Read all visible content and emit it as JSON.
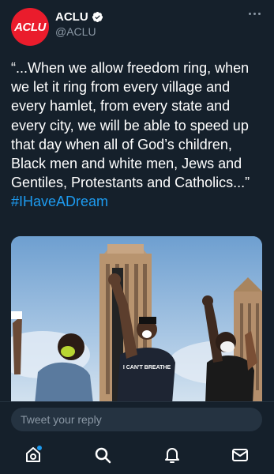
{
  "tweet": {
    "avatar_text": "ACLU",
    "display_name": "ACLU",
    "handle": "@ACLU",
    "text": "“...When we allow freedom ring, when we let it ring from every village and every hamlet, from every state and every city, we will be able to speed up that day when all of God’s children, Black men and white men, Jews and Gentiles, Protestants and Catholics...” ",
    "hashtag": "#IHaveADream",
    "sign_text": "I CAN'T BREATHE",
    "verified": true
  },
  "reply": {
    "placeholder": "Tweet your reply"
  },
  "tabs": [
    {
      "name": "home",
      "icon": "home-icon",
      "has_notification_dot": true
    },
    {
      "name": "search",
      "icon": "search-icon"
    },
    {
      "name": "notifications",
      "icon": "bell-icon"
    },
    {
      "name": "messages",
      "icon": "mail-icon"
    }
  ],
  "colors": {
    "background": "#15202b",
    "accent": "#1d9bf0",
    "brand": "#ea1c2c",
    "muted": "#8b98a5"
  }
}
